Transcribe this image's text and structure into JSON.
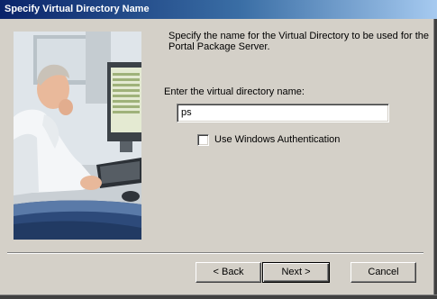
{
  "window": {
    "title": "Specify Virtual Directory Name"
  },
  "content": {
    "description": "Specify the name for the Virtual Directory to be used for the Portal Package Server.",
    "prompt_label": "Enter the virtual directory name:",
    "directory_name_value": "ps",
    "windows_auth_label": "Use Windows Authentication",
    "windows_auth_checked": false
  },
  "buttons": {
    "back_label": "< Back",
    "next_label": "Next >",
    "cancel_label": "Cancel"
  },
  "colors": {
    "title_bar_start": "#0a246a",
    "title_bar_end": "#a6caf0",
    "dialog_bg": "#d4d0c8"
  }
}
